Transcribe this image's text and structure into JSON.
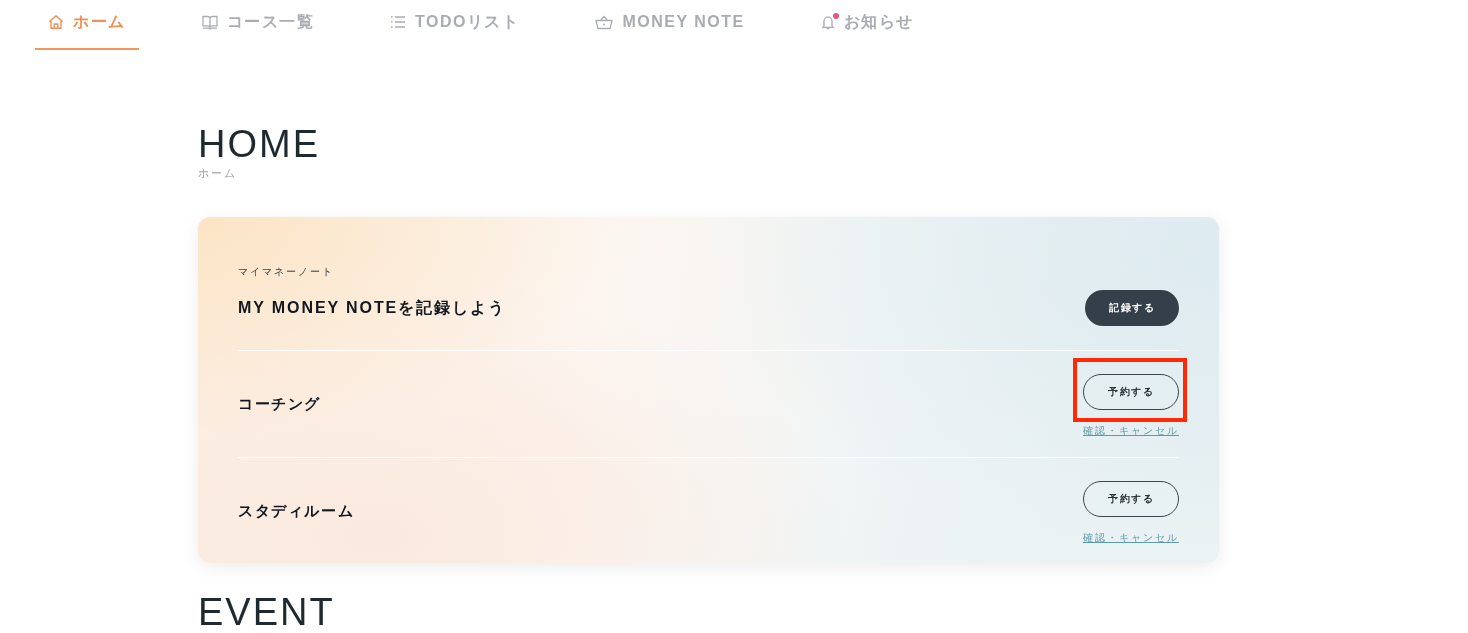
{
  "nav": {
    "items": [
      {
        "label": "ホーム",
        "selected": true,
        "notification": false
      },
      {
        "label": "コース一覧",
        "selected": false,
        "notification": false
      },
      {
        "label": "TODOリスト",
        "selected": false,
        "notification": false
      },
      {
        "label": "MONEY NOTE",
        "selected": false,
        "notification": false
      },
      {
        "label": "お知らせ",
        "selected": false,
        "notification": true
      }
    ]
  },
  "page": {
    "title": "HOME",
    "subtitle": "ホーム"
  },
  "card": {
    "rows": [
      {
        "kind": "note",
        "label": "マイマネーノート",
        "title": "MY MONEY NOTEを記録しよう",
        "button": "記録する",
        "highlighted": false
      },
      {
        "kind": "booking",
        "title": "コーチング",
        "button": "予約する",
        "link": "確認・キャンセル",
        "highlighted": true
      },
      {
        "kind": "booking",
        "title": "スタディルーム",
        "button": "予約する",
        "link": "確認・キャンセル",
        "highlighted": false
      }
    ]
  },
  "next_section": {
    "title": "EVENT"
  }
}
